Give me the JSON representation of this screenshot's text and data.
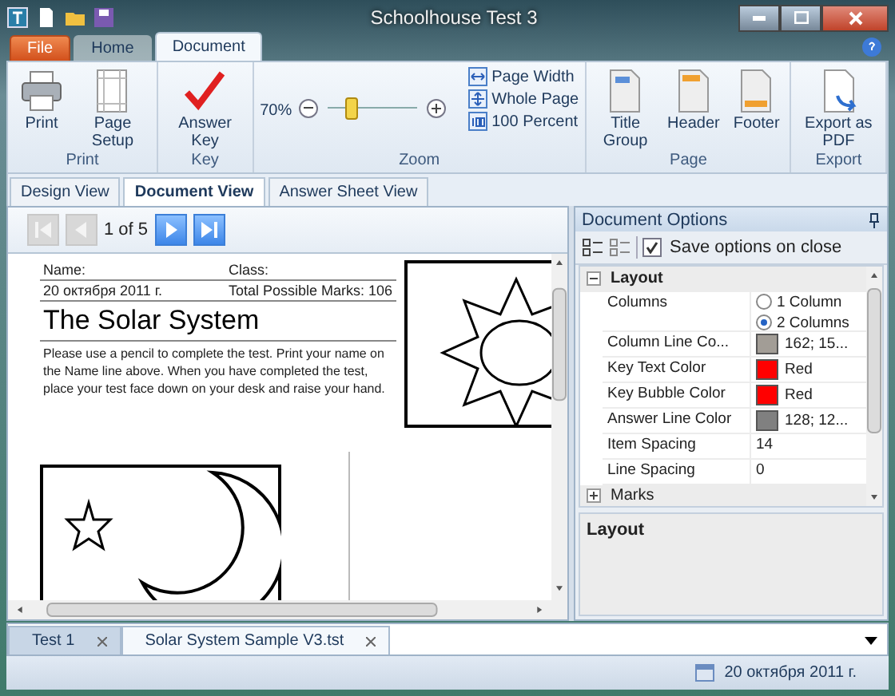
{
  "window": {
    "title": "Schoolhouse Test 3"
  },
  "ribbon_tabs": [
    {
      "label": "File",
      "kind": "file",
      "selected": false
    },
    {
      "label": "Home",
      "kind": "tab",
      "selected": false
    },
    {
      "label": "Document",
      "kind": "tab",
      "selected": true
    }
  ],
  "ribbon_groups": [
    {
      "label": "Print",
      "items": [
        {
          "label": "Print",
          "kind": "printer"
        },
        {
          "label": "Page Setup",
          "kind": "page-setup"
        }
      ]
    },
    {
      "label": "Key",
      "items": [
        {
          "label": "Answer Key",
          "kind": "check"
        }
      ]
    },
    {
      "label": "Zoom",
      "zoom": {
        "reading": "70%",
        "level": 0.27
      },
      "items": [
        {
          "label": "Page Width",
          "kind": "page-width"
        },
        {
          "label": "Whole Page",
          "kind": "whole-page"
        },
        {
          "label": "100 Percent",
          "kind": "actual-size"
        }
      ]
    },
    {
      "label": "Page",
      "items": [
        {
          "label": "Title Group",
          "kind": "title"
        },
        {
          "label": "Header",
          "kind": "header"
        },
        {
          "label": "Footer",
          "kind": "footer"
        }
      ]
    },
    {
      "label": "Export",
      "items": [
        {
          "label": "Export as PDF",
          "kind": "export"
        }
      ]
    }
  ],
  "view_tabs": [
    {
      "label": "Design View",
      "selected": false
    },
    {
      "label": "Document View",
      "selected": true
    },
    {
      "label": "Answer Sheet View",
      "selected": false
    }
  ],
  "pager": {
    "reading": "1 of 5",
    "buttons": [
      {
        "kind": "first",
        "disabled": true
      },
      {
        "kind": "prev",
        "disabled": true
      },
      {
        "kind": "next",
        "disabled": false
      },
      {
        "kind": "last",
        "disabled": false
      }
    ]
  },
  "document": {
    "name_label": "Name:",
    "class_label": "Class:",
    "date": "20 октября 2011 г.",
    "total_marks": "Total Possible Marks: 106",
    "title": "The Solar System",
    "instructions": "Please use a pencil to complete the test. Print your name on the Name line above. When you have completed the test, place your test face down on your desk and raise your hand."
  },
  "options_panel": {
    "title": "Document Options",
    "save_option": {
      "label": "Save options on close",
      "checked": true
    },
    "sections": [
      {
        "label": "Layout",
        "expanded": true,
        "properties": [
          {
            "name": "Columns",
            "kind": "radio",
            "options": [
              {
                "label": "1 Column",
                "selected": false
              },
              {
                "label": "2 Columns",
                "selected": true
              }
            ]
          },
          {
            "name": "Column Line Co...",
            "kind": "color",
            "color": "#a29d96",
            "value": "162; 15..."
          },
          {
            "name": "Key Text Color",
            "kind": "color",
            "color": "#ff0000",
            "value": "Red"
          },
          {
            "name": "Key Bubble Color",
            "kind": "color",
            "color": "#ff0000",
            "value": "Red"
          },
          {
            "name": "Answer Line Color",
            "kind": "color",
            "color": "#808080",
            "value": "128; 12..."
          },
          {
            "name": "Item Spacing",
            "kind": "text",
            "value": "14"
          },
          {
            "name": "Line Spacing",
            "kind": "text",
            "value": "0"
          }
        ]
      },
      {
        "label": "Marks",
        "expanded": false
      }
    ],
    "description_title": "Layout"
  },
  "doc_tabs": [
    {
      "label": "Test 1",
      "selected": false
    },
    {
      "label": "Solar System Sample V3.tst",
      "selected": true
    }
  ],
  "status_bar": {
    "date": "20 октября 2011 г."
  }
}
